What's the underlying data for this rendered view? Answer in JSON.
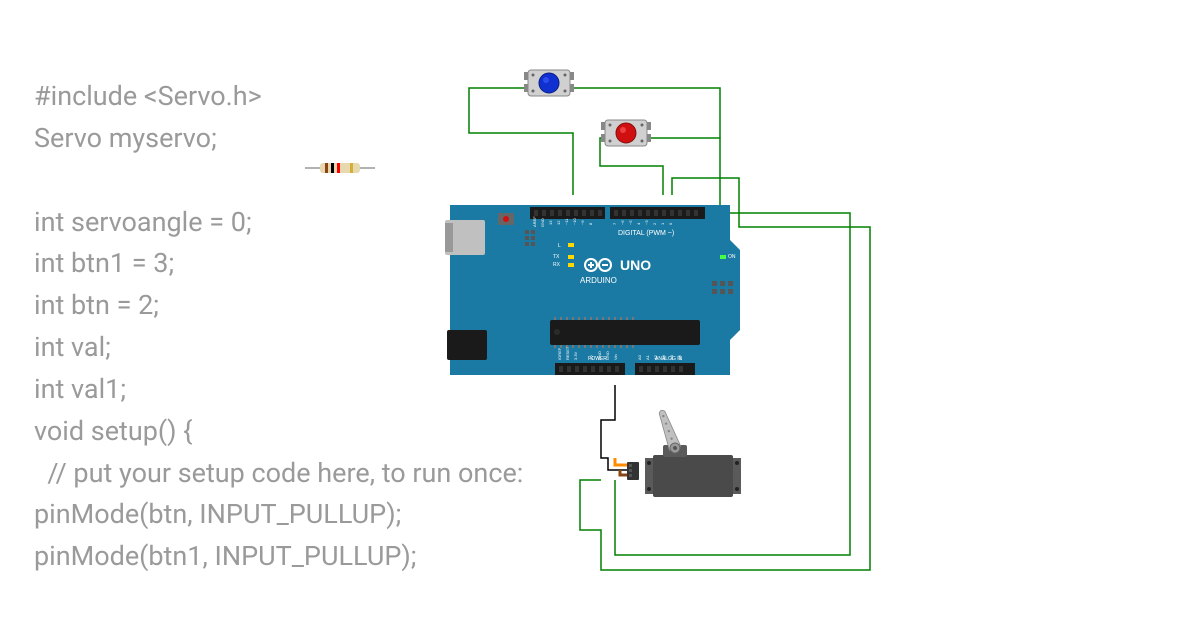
{
  "code": {
    "lines": [
      "#include <Servo.h>",
      "Servo myservo;",
      "",
      "int servoangle = 0;",
      "int btn1 = 3;",
      "int btn = 2;",
      "int val;",
      "int val1;",
      "void setup() {",
      "  // put your setup code here, to run once:",
      "pinMode(btn, INPUT_PULLUP);",
      "pinMode(btn1, INPUT_PULLUP);"
    ]
  },
  "arduino": {
    "brand": "ARDUINO",
    "model": "UNO",
    "labels": {
      "tx": "TX",
      "rx": "RX",
      "on": "ON",
      "l": "L",
      "digital": "DIGITAL (PWM ~)",
      "analog": "ANALOG IN",
      "power": "POWER",
      "aref": "AREF",
      "gnd": "GND",
      "ioref": "IOREF",
      "reset": "RESET",
      "v33": "3.3V",
      "v5": "5V",
      "vin": "Vin",
      "a0": "A0",
      "a1": "A1",
      "a2": "A2",
      "a3": "A3",
      "a4": "A4",
      "a5": "A5"
    }
  },
  "components": {
    "button_blue": "push-button-blue",
    "button_red": "push-button-red",
    "resistor": "resistor",
    "servo": "servo-motor"
  }
}
